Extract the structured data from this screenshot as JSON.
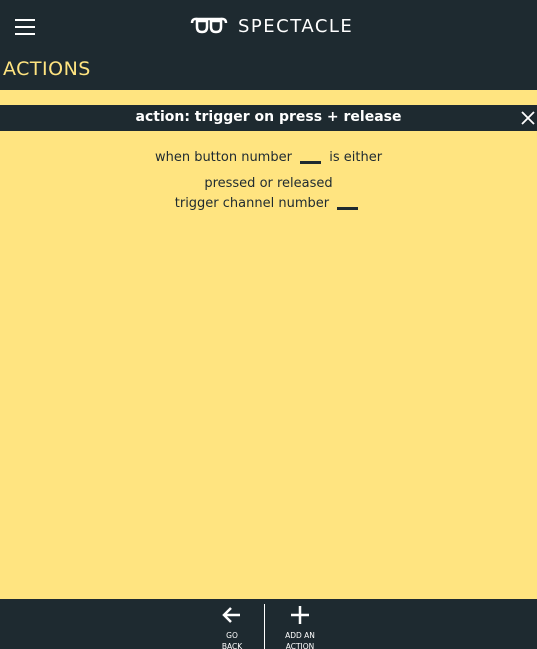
{
  "app": {
    "brand_name": "SPECTACLE",
    "logo_icon": "spectacles-logo-icon",
    "menu_icon": "hamburger-menu-icon"
  },
  "section": {
    "title": "ACTIONS"
  },
  "action_panel": {
    "title": "action: trigger on press + release",
    "close_icon": "close-icon",
    "line1_before": "when button number",
    "line1_after": "is either",
    "line2": "pressed or released",
    "line3_before": "trigger channel number",
    "button_number_value": "",
    "channel_number_value": ""
  },
  "footer": {
    "go_back_label": "GO\nBACK",
    "add_action_label": "ADD AN\nACTION",
    "go_back_icon": "arrow-left-icon",
    "add_action_icon": "plus-icon"
  },
  "colors": {
    "dark": "#1E2A30",
    "accent": "#FFE480",
    "text_light": "#FFFFFF"
  }
}
